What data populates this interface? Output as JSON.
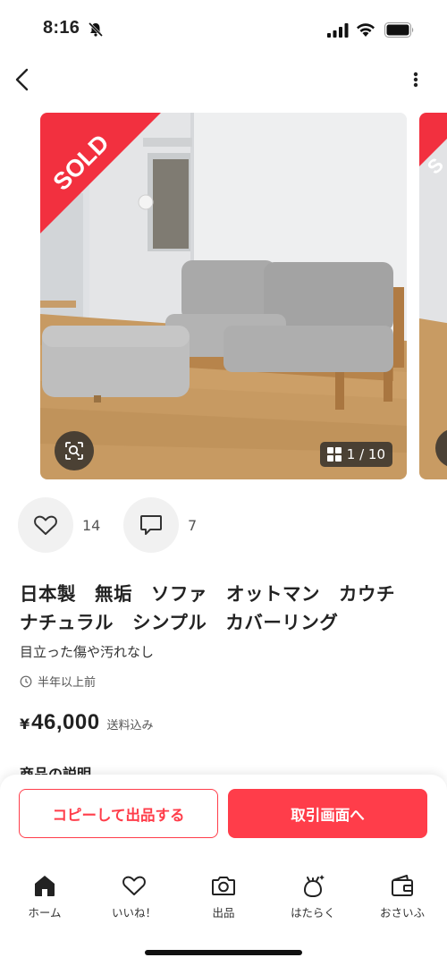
{
  "status_bar": {
    "time": "8:16"
  },
  "carousel": {
    "sold_label": "SOLD",
    "counter": "1 / 10"
  },
  "actions": {
    "likes_count": "14",
    "comments_count": "7"
  },
  "item": {
    "title": "日本製　無垢　ソファ　オットマン　カウチ　ナチュラル　シンプル　カバーリング",
    "condition": "目立った傷や汚れなし",
    "posted": "半年以上前",
    "price_symbol": "¥",
    "price": "46,000",
    "shipping_note": "送料込み",
    "description_heading": "商品の説明"
  },
  "buttons": {
    "copy_listing": "コピーして出品する",
    "trade_screen": "取引画面へ"
  },
  "tabbar": {
    "items": [
      {
        "label": "ホーム",
        "icon": "home-icon"
      },
      {
        "label": "いいね！",
        "icon": "heart-icon"
      },
      {
        "label": "出品",
        "icon": "camera-icon"
      },
      {
        "label": "はたらく",
        "icon": "work-icon"
      },
      {
        "label": "おさいふ",
        "icon": "wallet-icon"
      }
    ]
  },
  "colors": {
    "accent": "#ff3d4a",
    "sold_ribbon": "#f2303f"
  }
}
